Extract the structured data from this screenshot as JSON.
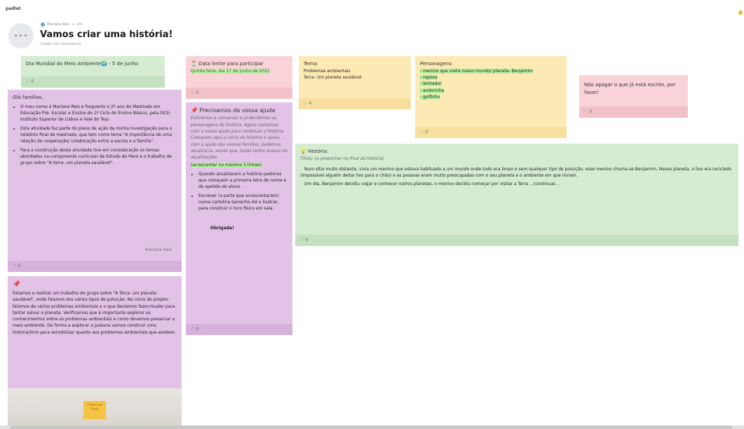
{
  "app": {
    "brand": "padlet"
  },
  "header": {
    "avatar_glyph": "•••",
    "author_name": "Mariana Reis",
    "author_sep": "+",
    "author_time": "1m",
    "title": "Vamos criar uma história!",
    "subtitle": "Criado com entusiasmo"
  },
  "colors": {
    "green": "#d5ebd2",
    "pink": "#f9d3d8",
    "yellow": "#fde9b4",
    "purple": "#e3c2e8",
    "highlight": "#b6f2a0"
  },
  "cards": {
    "dia_mundial": {
      "title": "Dia Mundial do Meio Ambiente🌍 - 5 de junho",
      "likes": "0"
    },
    "data_limite": {
      "title": "⏳ Data limite para participar",
      "body": "Quinta feira, dia 17 de junho de 2021",
      "likes": "0"
    },
    "tema": {
      "title": "Tema:",
      "line1": "Problemas ambientais",
      "line2": "Terra- Um planeta saudável",
      "likes": "4"
    },
    "personagens": {
      "title": "Personagens:",
      "items": [
        "- menino que visita nosso mundo/ planeta- Benjamim",
        "- raposa",
        "- lenhador",
        "- andorinha",
        "- golfinho"
      ],
      "likes": "0"
    },
    "nao_apagar": {
      "body": "Não apagar o que já está escrito, por favor!",
      "likes": "0"
    },
    "ola_familias": {
      "title": "Olá famílias,",
      "bullets": [
        "O meu nome é Mariana Reis e frequento o 2º ano do Mestrado em Educação Pré- Escolar e Ensino do 1º Ciclo do Ensino Básico, pela ISCE- Instituto Superior de Lisboa e Vale do Tejo.",
        "Esta atividade faz parte do plano de ação da minha investigação para o relatório final de mestrado, que tem como tema \"A importância de uma relação de cooperação/ colaboração entre a escola e a família\".",
        "Para a construção desta atividade tive em consideração os temas abordados na componente curricular de Estudo do Meio e o trabalho de grupo sobre \"A terra- um planeta saudável\"."
      ],
      "signature": "Mariana Reis",
      "likes": "0"
    },
    "precisamos": {
      "title": "📌 Precisamos da vossa ajuda",
      "intro": "Estivemos a conversar e já decidimos as personagens da história. Agora contamos com a vossa ajuda para continuar a história. Coloquem aqui o início da história e apoio, com a ajuda das vossas famílias, podemos atualizá-la, sendo que, todas tenho acesso de atualizações",
      "highlight": "(acrescentar no máximo 5 linhas)",
      "bullets": [
        "Quando atualizarem a história pedimos que coloquem a primeira letra do nome e do apelido do aluno.",
        "Escrever (a parte que acrescentaram) numa cartolina tamanho A4 e ilustrar, para construir o livro físico em sala."
      ],
      "thanks": "Obrigada!",
      "likes": "0"
    },
    "historia": {
      "title": "💡 História:",
      "subtitle": "Título- (a preencher no final da história)",
      "paragraph1": "Num sítio muito distante, vivia um menino que estava habituado a um mundo onde tudo era limpo e sem qualquer tipo de poluição, esse menino chama-se Benjamim. Nesse planeta, o lixo era reciclado (impossível alguém deitar lixo para o chão) e as pessoas eram muito preocupadas com o seu planeta e o ambiente em que viviam.",
      "paragraph2": "Um dia, Benjamim decidiu viajar e conhecer outros planetas, o menino decidiu começar por visitar a Terra ...(continua)...",
      "likes": "0"
    },
    "estamos": {
      "text": "Estamos a realizar um trabalho de grupo sobre \"A Terra- um planeta saudável\", onde falamos dos vários tipos de poluição. No início do projeto falamos de vários problemas ambientais e o que devíamos fazer/mudar para tentar salvar o planeta. Verificamos que é importante explorar os conhecimentos sobre os problemas ambientais e como devemos preservar o meio ambiente. De forma a explorar a palavra vamos construir uma história/livro para sensibilizar quanto aos problemas ambientais que existem.",
      "photo_note": "A Terra um lindo"
    }
  }
}
